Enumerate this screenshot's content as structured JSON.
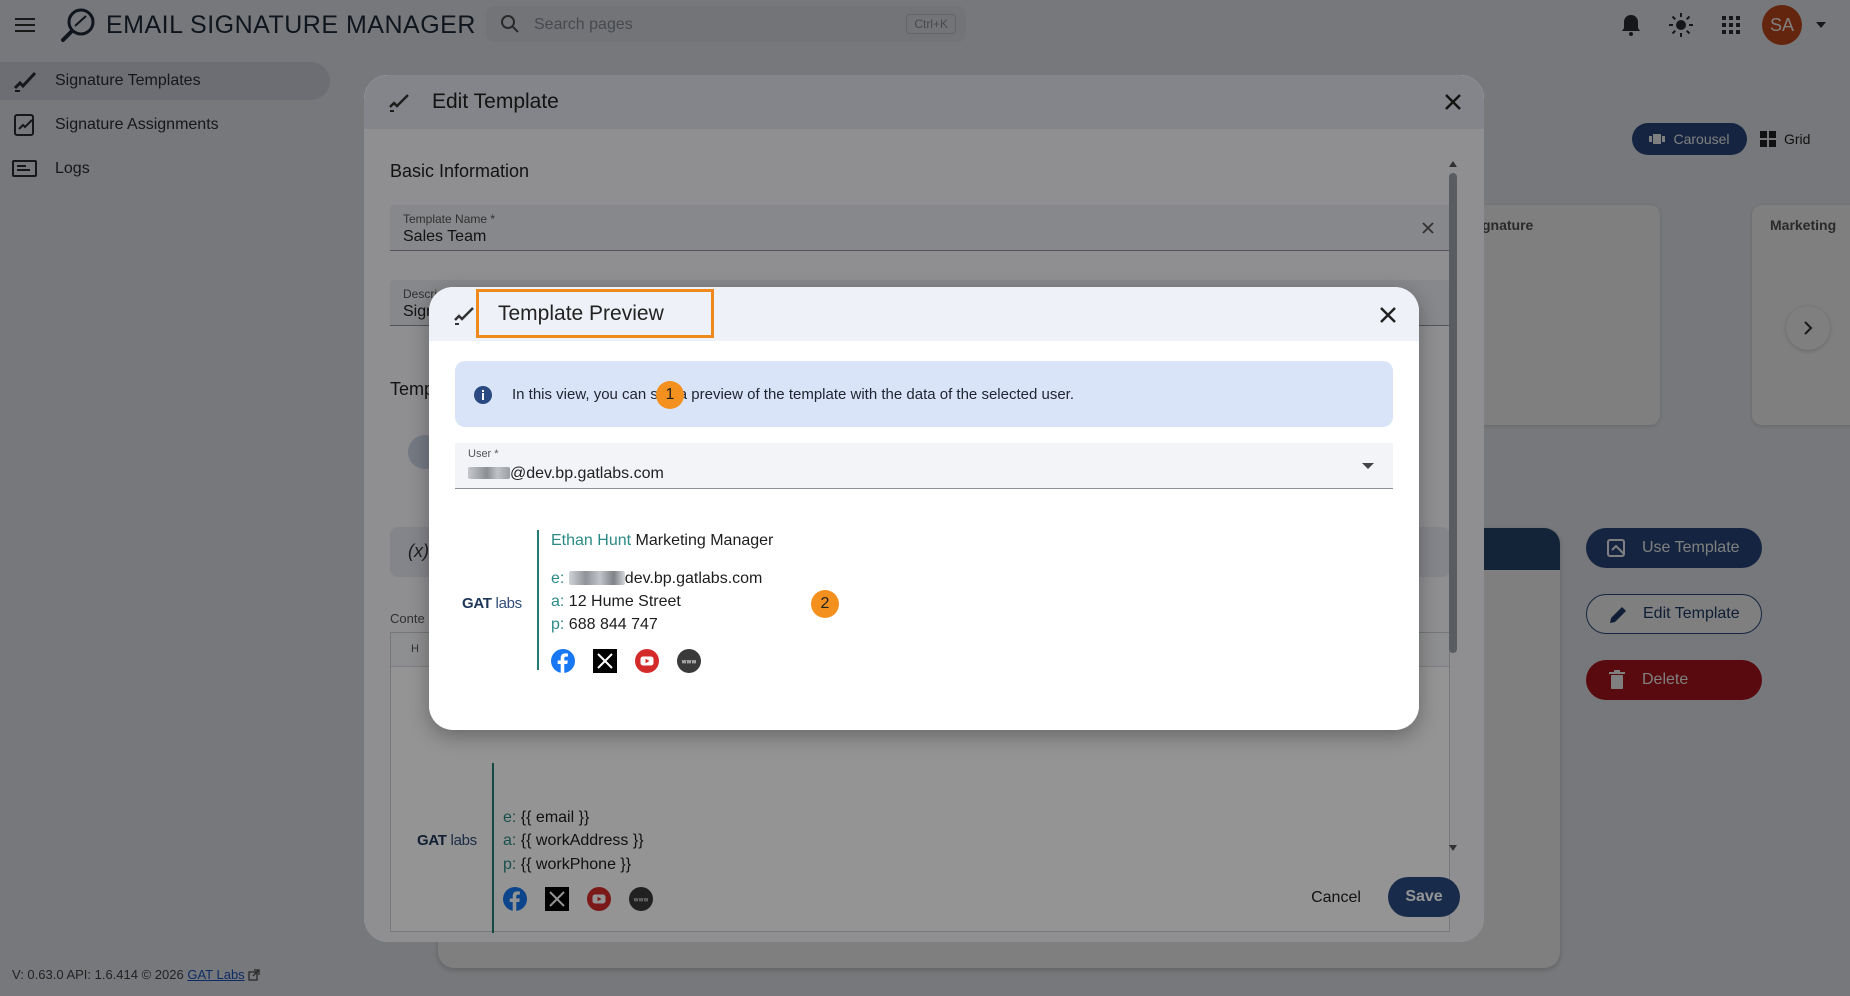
{
  "app": {
    "title": "EMAIL SIGNATURE MANAGER",
    "search_placeholder": "Search pages",
    "search_shortcut": "Ctrl+K",
    "avatar_initials": "SA"
  },
  "sidebar": {
    "items": [
      {
        "label": "Signature Templates",
        "icon": "signature-icon",
        "active": true
      },
      {
        "label": "Signature Assignments",
        "icon": "assignment-icon",
        "active": false
      },
      {
        "label": "Logs",
        "icon": "logs-icon",
        "active": false
      }
    ]
  },
  "footer": {
    "version": "V: 0.63.0  API: 1.6.414  © 2026",
    "link": "GAT Labs"
  },
  "background": {
    "carousel_label": "Carousel",
    "grid_label": "Grid",
    "card_titles": [
      "gnature",
      "Marketing"
    ],
    "actions": {
      "use": "Use Template",
      "edit": "Edit Template",
      "delete": "Delete"
    }
  },
  "edit_dialog": {
    "title": "Edit Template",
    "section_basic": "Basic Information",
    "template_name_label": "Template Name *",
    "template_name_value": "Sales Team",
    "description_label": "Descri",
    "description_value": "Sign",
    "section_template": "Temp",
    "fx_label": "(x)",
    "content_label": "Conte",
    "editor_toolbar": "H",
    "cancel": "Cancel",
    "save": "Save",
    "signature_template": {
      "email_key": "e:",
      "email_value": "{{ email }}",
      "address_key": "a:",
      "address_value": "{{ workAddress }}",
      "phone_key": "p:",
      "phone_value": "{{ workPhone }}"
    }
  },
  "preview_dialog": {
    "title": "Template Preview",
    "info_text": "In this view, you can see a preview of the template with the data of the selected user.",
    "user_label": "User *",
    "user_value_suffix": "@dev.bp.gatlabs.com",
    "step1": "1",
    "step2": "2",
    "signature": {
      "logo_gat": "GAT",
      "logo_labs": "labs",
      "name": "Ethan Hunt",
      "job_title": "Marketing Manager",
      "email_key": "e:",
      "email_value": "dev.bp.gatlabs.com",
      "address_key": "a:",
      "address_value": "12 Hume Street",
      "phone_key": "p:",
      "phone_value": "688 844 747",
      "socials": [
        "facebook-icon",
        "x-icon",
        "youtube-icon",
        "website-icon"
      ]
    }
  },
  "colors": {
    "primary": "#2b4a82",
    "danger": "#b3151c",
    "teal": "#2b8a86",
    "highlight": "#f0891c"
  }
}
